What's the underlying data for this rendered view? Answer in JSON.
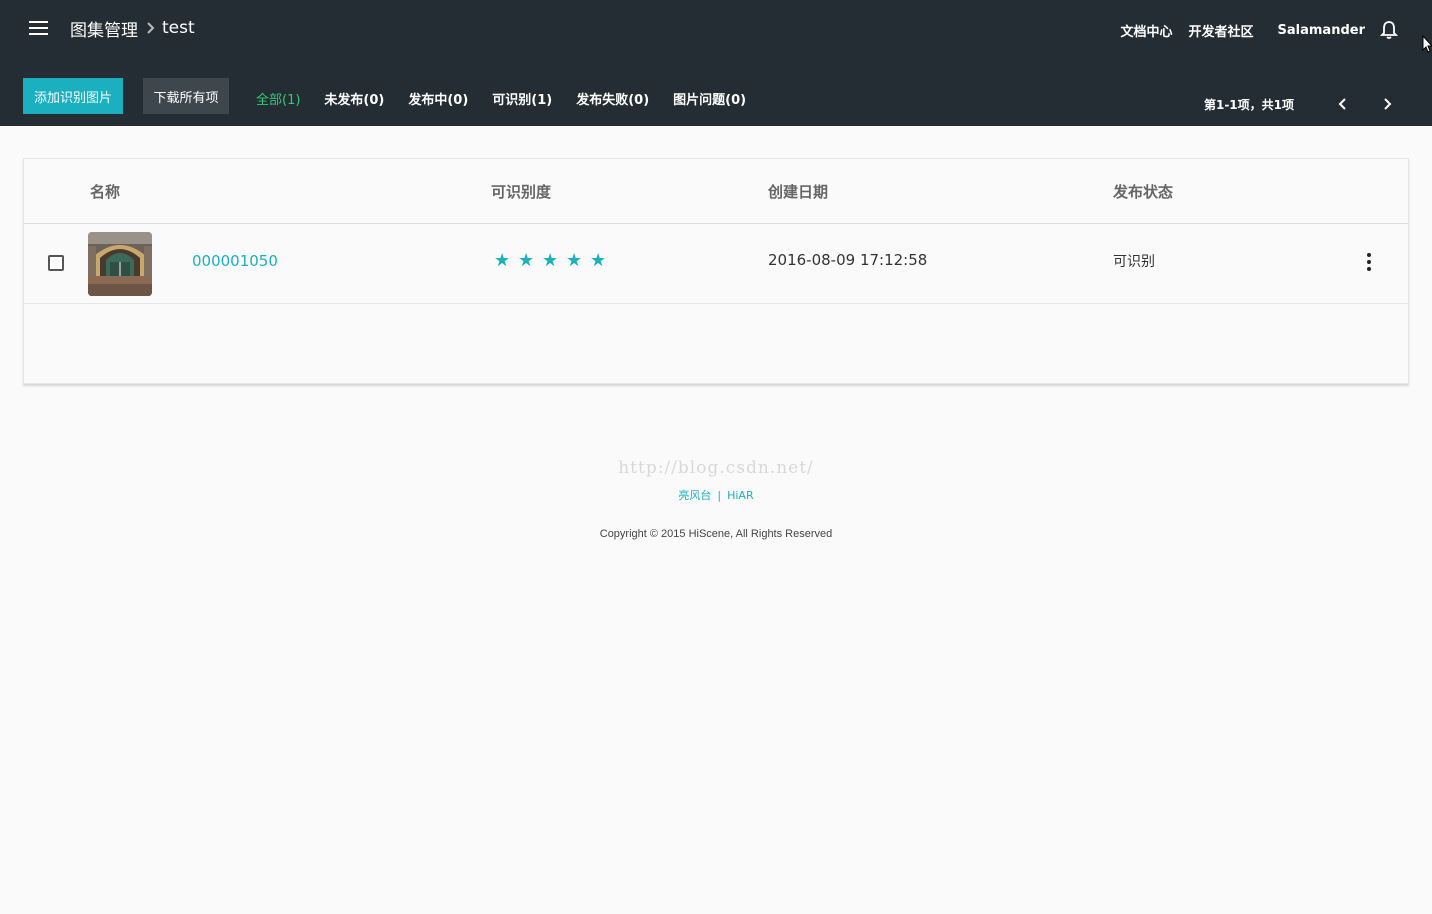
{
  "header": {
    "breadcrumb_root": "图集管理",
    "breadcrumb_current": "test",
    "links": {
      "docs": "文档中心",
      "community": "开发者社区"
    },
    "username": "Salamander"
  },
  "toolbar": {
    "add_label": "添加识别图片",
    "download_label": "下载所有项",
    "filters": [
      {
        "label": "全部(1)",
        "active": true
      },
      {
        "label": "未发布(0)"
      },
      {
        "label": "发布中(0)"
      },
      {
        "label": "可识别(1)"
      },
      {
        "label": "发布失败(0)"
      },
      {
        "label": "图片问题(0)"
      }
    ],
    "pager_info": "第1-1项，共1项"
  },
  "table": {
    "columns": {
      "name": "名称",
      "recognizability": "可识别度",
      "created": "创建日期",
      "status": "发布状态"
    },
    "rows": [
      {
        "name": "000001050",
        "stars": "★★★★★",
        "rating": 5,
        "created": "2016-08-09 17:12:58",
        "status": "可识别"
      }
    ]
  },
  "footer": {
    "watermark": "http://blog.csdn.net/",
    "links": [
      "亮风台",
      "HiAR"
    ],
    "separator": "|",
    "copyright": "Copyright © 2015 HiScene, All Rights Reserved"
  },
  "colors": {
    "accent": "#1ab0c0",
    "header_bg": "#252d34",
    "active_filter": "#2ecc71"
  }
}
